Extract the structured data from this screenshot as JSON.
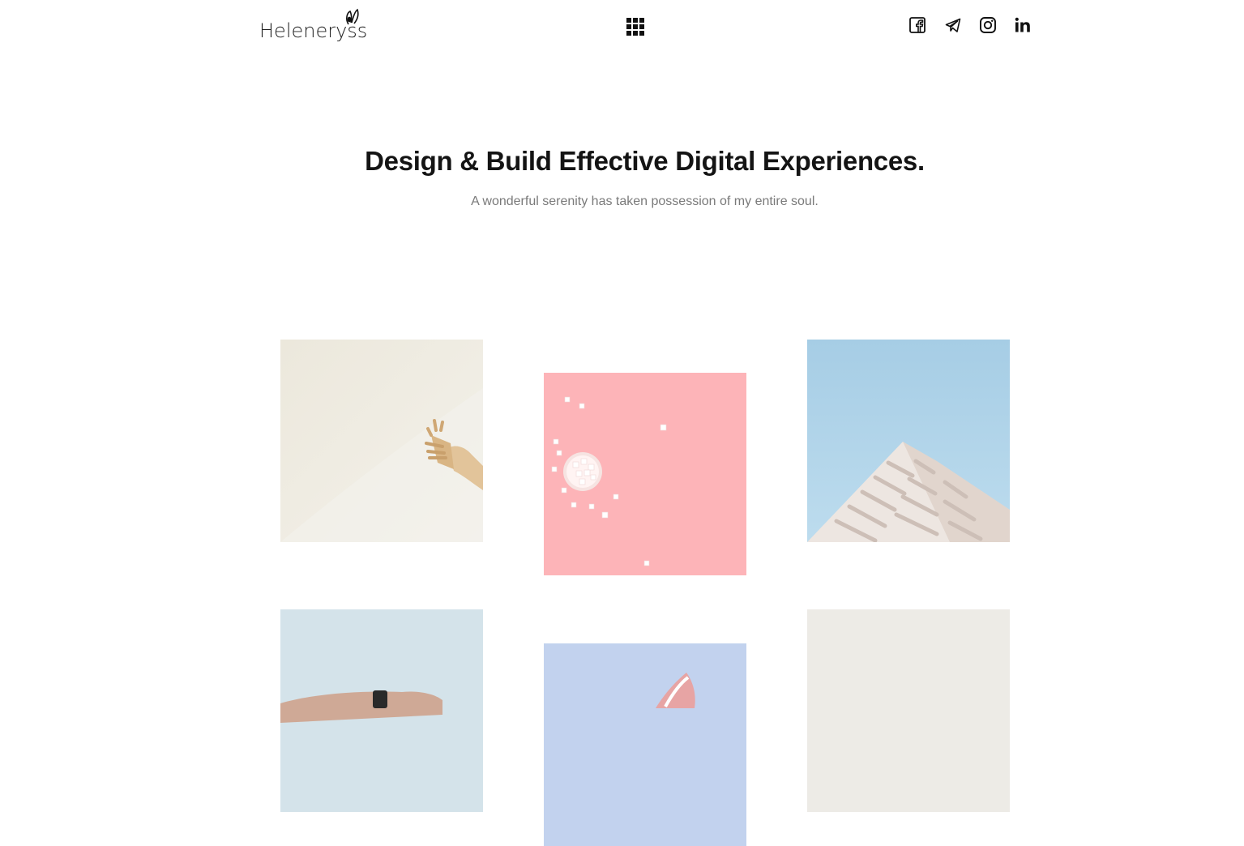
{
  "header": {
    "logo_text": "Heleneryss",
    "social": [
      {
        "name": "facebook-icon"
      },
      {
        "name": "telegram-icon"
      },
      {
        "name": "instagram-icon"
      },
      {
        "name": "linkedin-icon"
      }
    ]
  },
  "hero": {
    "title": "Design & Build Effective Digital Experiences.",
    "subtitle": "A wonderful serenity has taken possession of my entire soul."
  },
  "colors": {
    "text": "#141414",
    "muted": "#7a7a7a",
    "tile_cream": "#efebe2",
    "tile_pink": "#fdb6ba",
    "tile_sky": "#a9cfe6",
    "tile_pale_blue": "#d3e2ea",
    "tile_lavender": "#c2d2ee",
    "tile_grey": "#edebe6"
  }
}
